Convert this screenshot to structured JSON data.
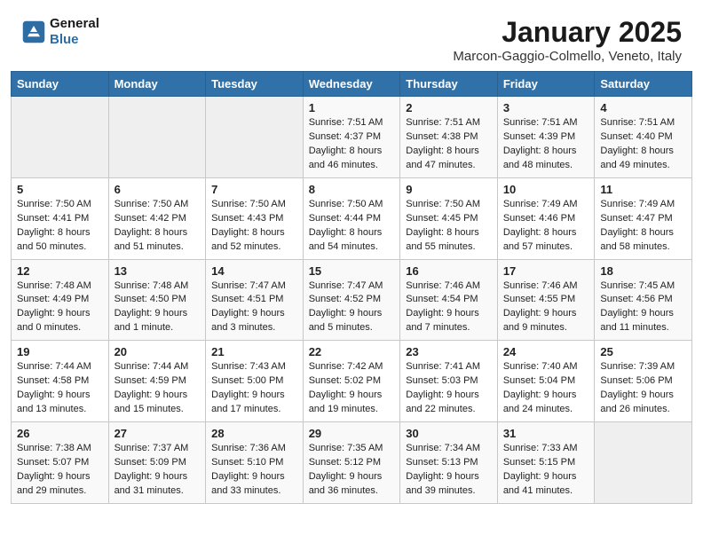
{
  "header": {
    "logo_line1": "General",
    "logo_line2": "Blue",
    "title": "January 2025",
    "subtitle": "Marcon-Gaggio-Colmello, Veneto, Italy"
  },
  "weekdays": [
    "Sunday",
    "Monday",
    "Tuesday",
    "Wednesday",
    "Thursday",
    "Friday",
    "Saturday"
  ],
  "weeks": [
    [
      {
        "day": "",
        "info": ""
      },
      {
        "day": "",
        "info": ""
      },
      {
        "day": "",
        "info": ""
      },
      {
        "day": "1",
        "info": "Sunrise: 7:51 AM\nSunset: 4:37 PM\nDaylight: 8 hours\nand 46 minutes."
      },
      {
        "day": "2",
        "info": "Sunrise: 7:51 AM\nSunset: 4:38 PM\nDaylight: 8 hours\nand 47 minutes."
      },
      {
        "day": "3",
        "info": "Sunrise: 7:51 AM\nSunset: 4:39 PM\nDaylight: 8 hours\nand 48 minutes."
      },
      {
        "day": "4",
        "info": "Sunrise: 7:51 AM\nSunset: 4:40 PM\nDaylight: 8 hours\nand 49 minutes."
      }
    ],
    [
      {
        "day": "5",
        "info": "Sunrise: 7:50 AM\nSunset: 4:41 PM\nDaylight: 8 hours\nand 50 minutes."
      },
      {
        "day": "6",
        "info": "Sunrise: 7:50 AM\nSunset: 4:42 PM\nDaylight: 8 hours\nand 51 minutes."
      },
      {
        "day": "7",
        "info": "Sunrise: 7:50 AM\nSunset: 4:43 PM\nDaylight: 8 hours\nand 52 minutes."
      },
      {
        "day": "8",
        "info": "Sunrise: 7:50 AM\nSunset: 4:44 PM\nDaylight: 8 hours\nand 54 minutes."
      },
      {
        "day": "9",
        "info": "Sunrise: 7:50 AM\nSunset: 4:45 PM\nDaylight: 8 hours\nand 55 minutes."
      },
      {
        "day": "10",
        "info": "Sunrise: 7:49 AM\nSunset: 4:46 PM\nDaylight: 8 hours\nand 57 minutes."
      },
      {
        "day": "11",
        "info": "Sunrise: 7:49 AM\nSunset: 4:47 PM\nDaylight: 8 hours\nand 58 minutes."
      }
    ],
    [
      {
        "day": "12",
        "info": "Sunrise: 7:48 AM\nSunset: 4:49 PM\nDaylight: 9 hours\nand 0 minutes."
      },
      {
        "day": "13",
        "info": "Sunrise: 7:48 AM\nSunset: 4:50 PM\nDaylight: 9 hours\nand 1 minute."
      },
      {
        "day": "14",
        "info": "Sunrise: 7:47 AM\nSunset: 4:51 PM\nDaylight: 9 hours\nand 3 minutes."
      },
      {
        "day": "15",
        "info": "Sunrise: 7:47 AM\nSunset: 4:52 PM\nDaylight: 9 hours\nand 5 minutes."
      },
      {
        "day": "16",
        "info": "Sunrise: 7:46 AM\nSunset: 4:54 PM\nDaylight: 9 hours\nand 7 minutes."
      },
      {
        "day": "17",
        "info": "Sunrise: 7:46 AM\nSunset: 4:55 PM\nDaylight: 9 hours\nand 9 minutes."
      },
      {
        "day": "18",
        "info": "Sunrise: 7:45 AM\nSunset: 4:56 PM\nDaylight: 9 hours\nand 11 minutes."
      }
    ],
    [
      {
        "day": "19",
        "info": "Sunrise: 7:44 AM\nSunset: 4:58 PM\nDaylight: 9 hours\nand 13 minutes."
      },
      {
        "day": "20",
        "info": "Sunrise: 7:44 AM\nSunset: 4:59 PM\nDaylight: 9 hours\nand 15 minutes."
      },
      {
        "day": "21",
        "info": "Sunrise: 7:43 AM\nSunset: 5:00 PM\nDaylight: 9 hours\nand 17 minutes."
      },
      {
        "day": "22",
        "info": "Sunrise: 7:42 AM\nSunset: 5:02 PM\nDaylight: 9 hours\nand 19 minutes."
      },
      {
        "day": "23",
        "info": "Sunrise: 7:41 AM\nSunset: 5:03 PM\nDaylight: 9 hours\nand 22 minutes."
      },
      {
        "day": "24",
        "info": "Sunrise: 7:40 AM\nSunset: 5:04 PM\nDaylight: 9 hours\nand 24 minutes."
      },
      {
        "day": "25",
        "info": "Sunrise: 7:39 AM\nSunset: 5:06 PM\nDaylight: 9 hours\nand 26 minutes."
      }
    ],
    [
      {
        "day": "26",
        "info": "Sunrise: 7:38 AM\nSunset: 5:07 PM\nDaylight: 9 hours\nand 29 minutes."
      },
      {
        "day": "27",
        "info": "Sunrise: 7:37 AM\nSunset: 5:09 PM\nDaylight: 9 hours\nand 31 minutes."
      },
      {
        "day": "28",
        "info": "Sunrise: 7:36 AM\nSunset: 5:10 PM\nDaylight: 9 hours\nand 33 minutes."
      },
      {
        "day": "29",
        "info": "Sunrise: 7:35 AM\nSunset: 5:12 PM\nDaylight: 9 hours\nand 36 minutes."
      },
      {
        "day": "30",
        "info": "Sunrise: 7:34 AM\nSunset: 5:13 PM\nDaylight: 9 hours\nand 39 minutes."
      },
      {
        "day": "31",
        "info": "Sunrise: 7:33 AM\nSunset: 5:15 PM\nDaylight: 9 hours\nand 41 minutes."
      },
      {
        "day": "",
        "info": ""
      }
    ]
  ]
}
